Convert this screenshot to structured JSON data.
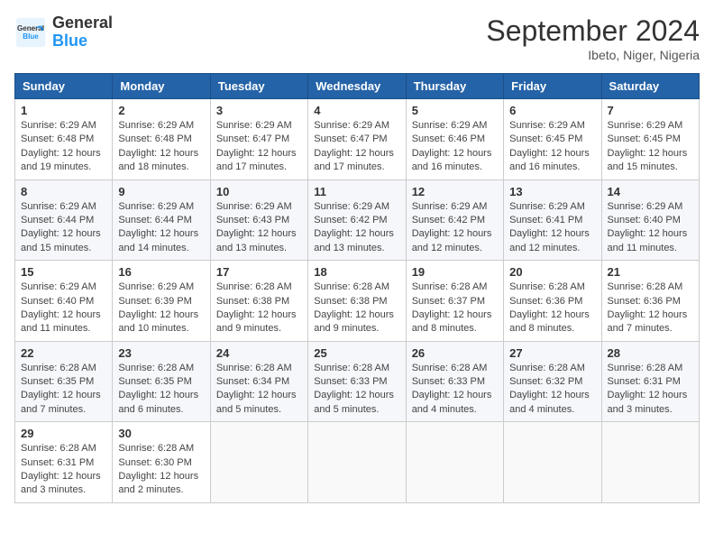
{
  "logo": {
    "line1": "General",
    "line2": "Blue"
  },
  "title": "September 2024",
  "location": "Ibeto, Niger, Nigeria",
  "days_of_week": [
    "Sunday",
    "Monday",
    "Tuesday",
    "Wednesday",
    "Thursday",
    "Friday",
    "Saturday"
  ],
  "weeks": [
    [
      {
        "num": "1",
        "sunrise": "6:29 AM",
        "sunset": "6:48 PM",
        "daylight": "12 hours and 19 minutes."
      },
      {
        "num": "2",
        "sunrise": "6:29 AM",
        "sunset": "6:48 PM",
        "daylight": "12 hours and 18 minutes."
      },
      {
        "num": "3",
        "sunrise": "6:29 AM",
        "sunset": "6:47 PM",
        "daylight": "12 hours and 17 minutes."
      },
      {
        "num": "4",
        "sunrise": "6:29 AM",
        "sunset": "6:47 PM",
        "daylight": "12 hours and 17 minutes."
      },
      {
        "num": "5",
        "sunrise": "6:29 AM",
        "sunset": "6:46 PM",
        "daylight": "12 hours and 16 minutes."
      },
      {
        "num": "6",
        "sunrise": "6:29 AM",
        "sunset": "6:45 PM",
        "daylight": "12 hours and 16 minutes."
      },
      {
        "num": "7",
        "sunrise": "6:29 AM",
        "sunset": "6:45 PM",
        "daylight": "12 hours and 15 minutes."
      }
    ],
    [
      {
        "num": "8",
        "sunrise": "6:29 AM",
        "sunset": "6:44 PM",
        "daylight": "12 hours and 15 minutes."
      },
      {
        "num": "9",
        "sunrise": "6:29 AM",
        "sunset": "6:44 PM",
        "daylight": "12 hours and 14 minutes."
      },
      {
        "num": "10",
        "sunrise": "6:29 AM",
        "sunset": "6:43 PM",
        "daylight": "12 hours and 13 minutes."
      },
      {
        "num": "11",
        "sunrise": "6:29 AM",
        "sunset": "6:42 PM",
        "daylight": "12 hours and 13 minutes."
      },
      {
        "num": "12",
        "sunrise": "6:29 AM",
        "sunset": "6:42 PM",
        "daylight": "12 hours and 12 minutes."
      },
      {
        "num": "13",
        "sunrise": "6:29 AM",
        "sunset": "6:41 PM",
        "daylight": "12 hours and 12 minutes."
      },
      {
        "num": "14",
        "sunrise": "6:29 AM",
        "sunset": "6:40 PM",
        "daylight": "12 hours and 11 minutes."
      }
    ],
    [
      {
        "num": "15",
        "sunrise": "6:29 AM",
        "sunset": "6:40 PM",
        "daylight": "12 hours and 11 minutes."
      },
      {
        "num": "16",
        "sunrise": "6:29 AM",
        "sunset": "6:39 PM",
        "daylight": "12 hours and 10 minutes."
      },
      {
        "num": "17",
        "sunrise": "6:28 AM",
        "sunset": "6:38 PM",
        "daylight": "12 hours and 9 minutes."
      },
      {
        "num": "18",
        "sunrise": "6:28 AM",
        "sunset": "6:38 PM",
        "daylight": "12 hours and 9 minutes."
      },
      {
        "num": "19",
        "sunrise": "6:28 AM",
        "sunset": "6:37 PM",
        "daylight": "12 hours and 8 minutes."
      },
      {
        "num": "20",
        "sunrise": "6:28 AM",
        "sunset": "6:36 PM",
        "daylight": "12 hours and 8 minutes."
      },
      {
        "num": "21",
        "sunrise": "6:28 AM",
        "sunset": "6:36 PM",
        "daylight": "12 hours and 7 minutes."
      }
    ],
    [
      {
        "num": "22",
        "sunrise": "6:28 AM",
        "sunset": "6:35 PM",
        "daylight": "12 hours and 7 minutes."
      },
      {
        "num": "23",
        "sunrise": "6:28 AM",
        "sunset": "6:35 PM",
        "daylight": "12 hours and 6 minutes."
      },
      {
        "num": "24",
        "sunrise": "6:28 AM",
        "sunset": "6:34 PM",
        "daylight": "12 hours and 5 minutes."
      },
      {
        "num": "25",
        "sunrise": "6:28 AM",
        "sunset": "6:33 PM",
        "daylight": "12 hours and 5 minutes."
      },
      {
        "num": "26",
        "sunrise": "6:28 AM",
        "sunset": "6:33 PM",
        "daylight": "12 hours and 4 minutes."
      },
      {
        "num": "27",
        "sunrise": "6:28 AM",
        "sunset": "6:32 PM",
        "daylight": "12 hours and 4 minutes."
      },
      {
        "num": "28",
        "sunrise": "6:28 AM",
        "sunset": "6:31 PM",
        "daylight": "12 hours and 3 minutes."
      }
    ],
    [
      {
        "num": "29",
        "sunrise": "6:28 AM",
        "sunset": "6:31 PM",
        "daylight": "12 hours and 3 minutes."
      },
      {
        "num": "30",
        "sunrise": "6:28 AM",
        "sunset": "6:30 PM",
        "daylight": "12 hours and 2 minutes."
      },
      null,
      null,
      null,
      null,
      null
    ]
  ],
  "labels": {
    "sunrise": "Sunrise:",
    "sunset": "Sunset:",
    "daylight": "Daylight:"
  }
}
